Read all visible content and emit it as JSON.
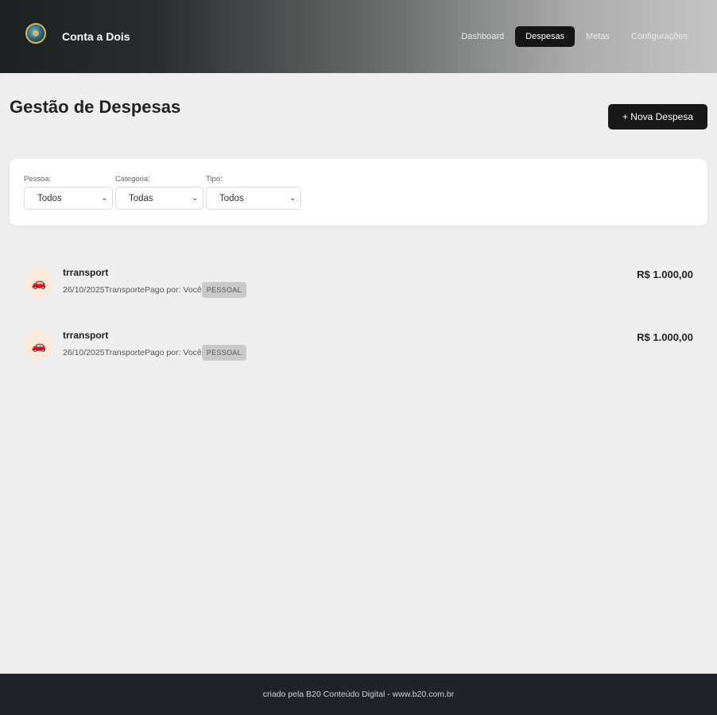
{
  "header": {
    "logo_icon": "coin-logo-icon",
    "brand": "Conta a Dois",
    "nav": [
      {
        "label": "Dashboard",
        "active": false
      },
      {
        "label": "Despesas",
        "active": true
      },
      {
        "label": "Metas",
        "active": false
      },
      {
        "label": "Configurações",
        "active": false
      }
    ]
  },
  "main": {
    "title": "Gestão de Despesas",
    "new_button": "+ Nova Despesa",
    "filters": [
      {
        "label": "Pessoa:",
        "value": "Todos"
      },
      {
        "label": "Categoria:",
        "value": "Todas"
      },
      {
        "label": "Tipo:",
        "value": "Todos"
      }
    ],
    "expenses": [
      {
        "icon": "car-icon",
        "name": "trransport",
        "date": "26/10/2025",
        "category": "Transporte",
        "paid_by": "Pago por: Você",
        "type": "PESSOAL",
        "amount": "R$ 1.000,00"
      },
      {
        "icon": "car-icon",
        "name": "trransport",
        "date": "26/10/2025",
        "category": "Transporte",
        "paid_by": "Pago por: Você",
        "type": "PESSOAL",
        "amount": "R$ 1.000,00"
      }
    ]
  },
  "footer": {
    "text": "criado pela B20 Conteúdo Digital - www.b20.com.br"
  },
  "colors": {
    "header_dark": "#1c2124",
    "active_nav": "#141618",
    "primary_button": "#16181a",
    "footer_bg": "#1f242c",
    "badge_bg": "#c9c9c9",
    "icon_bg": "#fbe9da"
  }
}
